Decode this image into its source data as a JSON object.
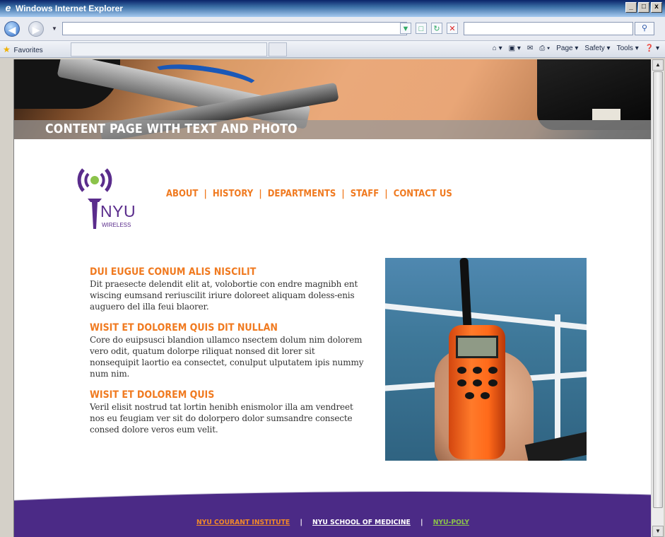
{
  "window": {
    "title": "Windows Internet Explorer",
    "controls": [
      "_",
      "□",
      "x"
    ]
  },
  "addressbar": {
    "url": "",
    "search_placeholder": ""
  },
  "commandbar": {
    "favorites_label": "Favorites",
    "items": [
      "Page",
      "Safety",
      "Tools"
    ]
  },
  "hero": {
    "title": "CONTENT PAGE WITH TEXT AND PHOTO"
  },
  "logo": {
    "name": "NYU",
    "subtitle": "WIRELESS"
  },
  "nav": {
    "items": [
      "ABOUT",
      "HISTORY",
      "DEPARTMENTS",
      "STAFF",
      "CONTACT US"
    ]
  },
  "content": {
    "sections": [
      {
        "heading": "DUI EUGUE CONUM ALIS NISCILIT",
        "body": "Dit praesecte delendit elit at, volobortie con endre magnibh ent wiscing eumsand reriuscilit iriure doloreet aliquam doless-enis auguero del illa feui blaorer."
      },
      {
        "heading": "WISIT ET DOLOREM QUIS DIT NULLAN",
        "body": "Core do euipsusci blandion ullamco nsectem dolum nim dolorem vero odit, quatum dolorpe riliquat nonsed dit lorer sit nonsequipit laortio ea consectet, conulput ulputatem ipis nummy num nim."
      },
      {
        "heading": "WISIT ET DOLOREM QUIS",
        "body": "Veril elisit nostrud tat lortin henibh enismolor illa am vendreet nos eu feugiam ver sit do dolorpero dolor sumsandre consecte consed dolore veros eum velit."
      }
    ]
  },
  "footer": {
    "links": [
      "NYU COURANT INSTITUTE",
      "NYU SCHOOL OF MEDICINE",
      "NYU-POLY"
    ],
    "separator": "|"
  },
  "colors": {
    "accent_orange": "#f07a20",
    "brand_purple": "#5a2c8c",
    "footer_purple": "#4b2a86",
    "poly_green": "#8bc34a"
  }
}
